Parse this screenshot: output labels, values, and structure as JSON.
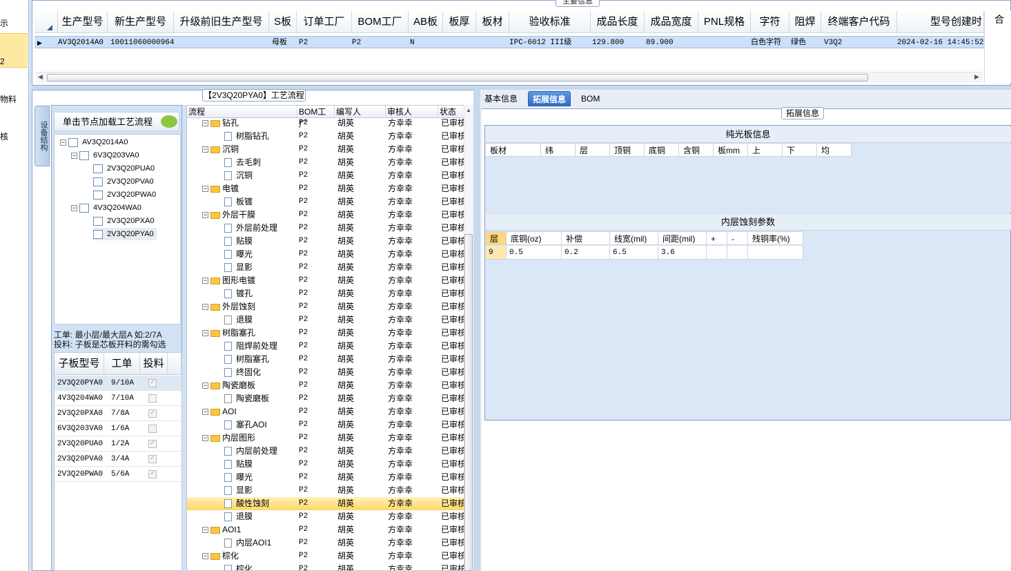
{
  "leftnav": {
    "items": [
      "示",
      "2",
      "物料",
      "核"
    ]
  },
  "top": {
    "title": "主要信息",
    "columns": [
      "生产型号",
      "新生产型号",
      "升级前旧生产型号",
      "S板",
      "订单工厂",
      "BOM工厂",
      "AB板",
      "板厚",
      "板材",
      "验收标准",
      "成品长度",
      "成品宽度",
      "PNL规格",
      "字符",
      "阻焊",
      "终端客户代码",
      "型号创建时"
    ],
    "row": {
      "c0": "AV3Q2014A0",
      "c1": "10011060000964",
      "c3": "母板",
      "c4": "P2",
      "c5": "P2",
      "c6": "N",
      "c9": "IPC-6012 III级",
      "c10": "129.800",
      "c11": "89.900",
      "c13": "白色字符",
      "c14": "绿色",
      "c15": "V3Q2",
      "c16": "2024-02-16 14:45:52"
    },
    "right_label": "合"
  },
  "flow_title": "【2V3Q20PYA0】工艺流程",
  "vtab_label": "设备结构",
  "tree": {
    "header": "单击节点加载工艺流程",
    "nodes": [
      {
        "label": "AV3Q2014A0"
      },
      {
        "label": "6V3Q203VA0"
      },
      {
        "label": "2V3Q20PUA0"
      },
      {
        "label": "2V3Q20PVA0"
      },
      {
        "label": "2V3Q20PWA0"
      },
      {
        "label": "4V3Q204WA0"
      },
      {
        "label": "2V3Q20PXA0"
      },
      {
        "label": "2V3Q20PYA0"
      }
    ]
  },
  "hint": {
    "line1": "工单: 最小层/最大层A 如:2/7A",
    "line2": "投料: 子板是芯板开料的需勾选"
  },
  "subgrid": {
    "headers": [
      "子板型号",
      "工单",
      "投料"
    ],
    "rows": [
      {
        "model": "2V3Q20PYA0",
        "order": "9/10A",
        "checked": true
      },
      {
        "model": "4V3Q204WA0",
        "order": "7/10A",
        "checked": false
      },
      {
        "model": "2V3Q20PXA0",
        "order": "7/8A",
        "checked": true
      },
      {
        "model": "6V3Q203VA0",
        "order": "1/6A",
        "checked": false
      },
      {
        "model": "2V3Q20PUA0",
        "order": "1/2A",
        "checked": true
      },
      {
        "model": "2V3Q20PVA0",
        "order": "3/4A",
        "checked": true
      },
      {
        "model": "2V3Q20PWA0",
        "order": "5/6A",
        "checked": true
      }
    ]
  },
  "flow": {
    "headers": [
      "流程",
      "BOM工厂",
      "编写人",
      "审核人",
      "状态"
    ],
    "bom": "P2",
    "writer": "胡英",
    "reviewer": "方幸幸",
    "status": "已审核",
    "rows": [
      {
        "type": "folder",
        "name": "钻孔"
      },
      {
        "type": "doc",
        "name": "树脂钻孔"
      },
      {
        "type": "folder",
        "name": "沉铜"
      },
      {
        "type": "doc",
        "name": "去毛刺"
      },
      {
        "type": "doc",
        "name": "沉铜"
      },
      {
        "type": "folder",
        "name": "电镀"
      },
      {
        "type": "doc",
        "name": "板镀"
      },
      {
        "type": "folder",
        "name": "外层干膜"
      },
      {
        "type": "doc",
        "name": "外层前处理"
      },
      {
        "type": "doc",
        "name": "贴膜"
      },
      {
        "type": "doc",
        "name": "曝光"
      },
      {
        "type": "doc",
        "name": "显影"
      },
      {
        "type": "folder",
        "name": "图形电镀"
      },
      {
        "type": "doc",
        "name": "镀孔"
      },
      {
        "type": "folder",
        "name": "外层蚀刻"
      },
      {
        "type": "doc",
        "name": "退膜"
      },
      {
        "type": "folder",
        "name": "树脂塞孔"
      },
      {
        "type": "doc",
        "name": "阻焊前处理"
      },
      {
        "type": "doc",
        "name": "树脂塞孔"
      },
      {
        "type": "doc",
        "name": "终固化"
      },
      {
        "type": "folder",
        "name": "陶瓷磨板"
      },
      {
        "type": "doc",
        "name": "陶瓷磨板"
      },
      {
        "type": "folder",
        "name": "AOI"
      },
      {
        "type": "doc",
        "name": "塞孔AOI"
      },
      {
        "type": "folder",
        "name": "内层图形"
      },
      {
        "type": "doc",
        "name": "内层前处理"
      },
      {
        "type": "doc",
        "name": "贴膜"
      },
      {
        "type": "doc",
        "name": "曝光"
      },
      {
        "type": "doc",
        "name": "显影"
      },
      {
        "type": "doc",
        "name": "酸性蚀刻",
        "selected": true
      },
      {
        "type": "doc",
        "name": "退膜"
      },
      {
        "type": "folder",
        "name": "AOI1"
      },
      {
        "type": "doc",
        "name": "内层AOI1"
      },
      {
        "type": "folder",
        "name": "棕化"
      },
      {
        "type": "doc",
        "name": "棕化"
      }
    ]
  },
  "right": {
    "tabs": [
      "基本信息",
      "拓展信息",
      "BOM"
    ],
    "ext_title": "拓展信息",
    "section1": {
      "title": "纯光板信息",
      "headers": [
        "板材",
        "纬",
        "层",
        "顶铜",
        "底铜",
        "含铜",
        "板mm",
        "上",
        "下",
        "均"
      ]
    },
    "section2": {
      "title": "内层蚀刻参数",
      "headers": [
        "层",
        "底铜(oz)",
        "补偿",
        "线宽(mil)",
        "间距(mil)",
        "+",
        "-",
        "残铜率(%)"
      ],
      "row": [
        "9",
        "0.5",
        "0.2",
        "6.5",
        "3.6",
        "",
        "",
        ""
      ]
    }
  },
  "colors": {
    "selected_row": "#cce0f7",
    "tab_active": "#2f6fc4",
    "highlight": "#ffd767"
  }
}
